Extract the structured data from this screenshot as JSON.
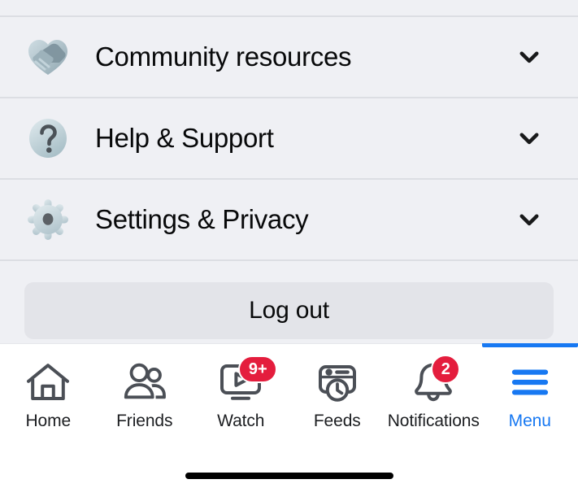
{
  "theme": {
    "page_bg": "#eff0f4",
    "divider": "#dcdee3",
    "tabbar_bg": "#ffffff",
    "accent_blue": "#1778f2",
    "badge_red": "#e41d3d",
    "text_primary": "#08090a",
    "logout_bg": "#e3e4e9"
  },
  "menu": {
    "rows": [
      {
        "label": "Community resources",
        "icon": "handshake-heart-icon",
        "chevron": "chevron-down-icon",
        "expanded": false
      },
      {
        "label": "Help & Support",
        "icon": "question-mark-circle-icon",
        "chevron": "chevron-down-icon",
        "expanded": false
      },
      {
        "label": "Settings & Privacy",
        "icon": "gear-icon",
        "chevron": "chevron-down-icon",
        "expanded": false
      }
    ]
  },
  "logout": {
    "label": "Log out"
  },
  "tabbar": {
    "active_tab": "Menu",
    "tabs": [
      {
        "label": "Home",
        "icon": "home-icon",
        "badge": "",
        "active": false
      },
      {
        "label": "Friends",
        "icon": "friends-icon",
        "badge": "",
        "active": false
      },
      {
        "label": "Watch",
        "icon": "watch-icon",
        "badge": "9+",
        "active": false
      },
      {
        "label": "Feeds",
        "icon": "feeds-icon",
        "badge": "",
        "active": false
      },
      {
        "label": "Notifications",
        "icon": "bell-icon",
        "badge": "2",
        "active": false
      },
      {
        "label": "Menu",
        "icon": "hamburger-menu-icon",
        "badge": "",
        "active": true
      }
    ]
  },
  "system": {
    "home_indicator": "home-indicator-bar"
  }
}
